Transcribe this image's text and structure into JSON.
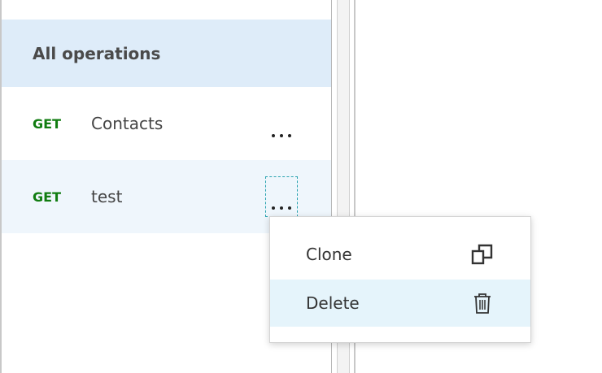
{
  "operations_panel": {
    "all_operations_label": "All operations",
    "items": [
      {
        "method": "GET",
        "name": "Contacts"
      },
      {
        "method": "GET",
        "name": "test"
      }
    ]
  },
  "context_menu": {
    "items": [
      {
        "label": "Clone",
        "icon": "clone-icon"
      },
      {
        "label": "Delete",
        "icon": "trash-icon"
      }
    ]
  },
  "colors": {
    "selected_row_bg": "#deecf9",
    "hover_row_bg": "#eff6fc",
    "method_get": "#107c10",
    "menu_hover_bg": "#e5f4fb"
  }
}
